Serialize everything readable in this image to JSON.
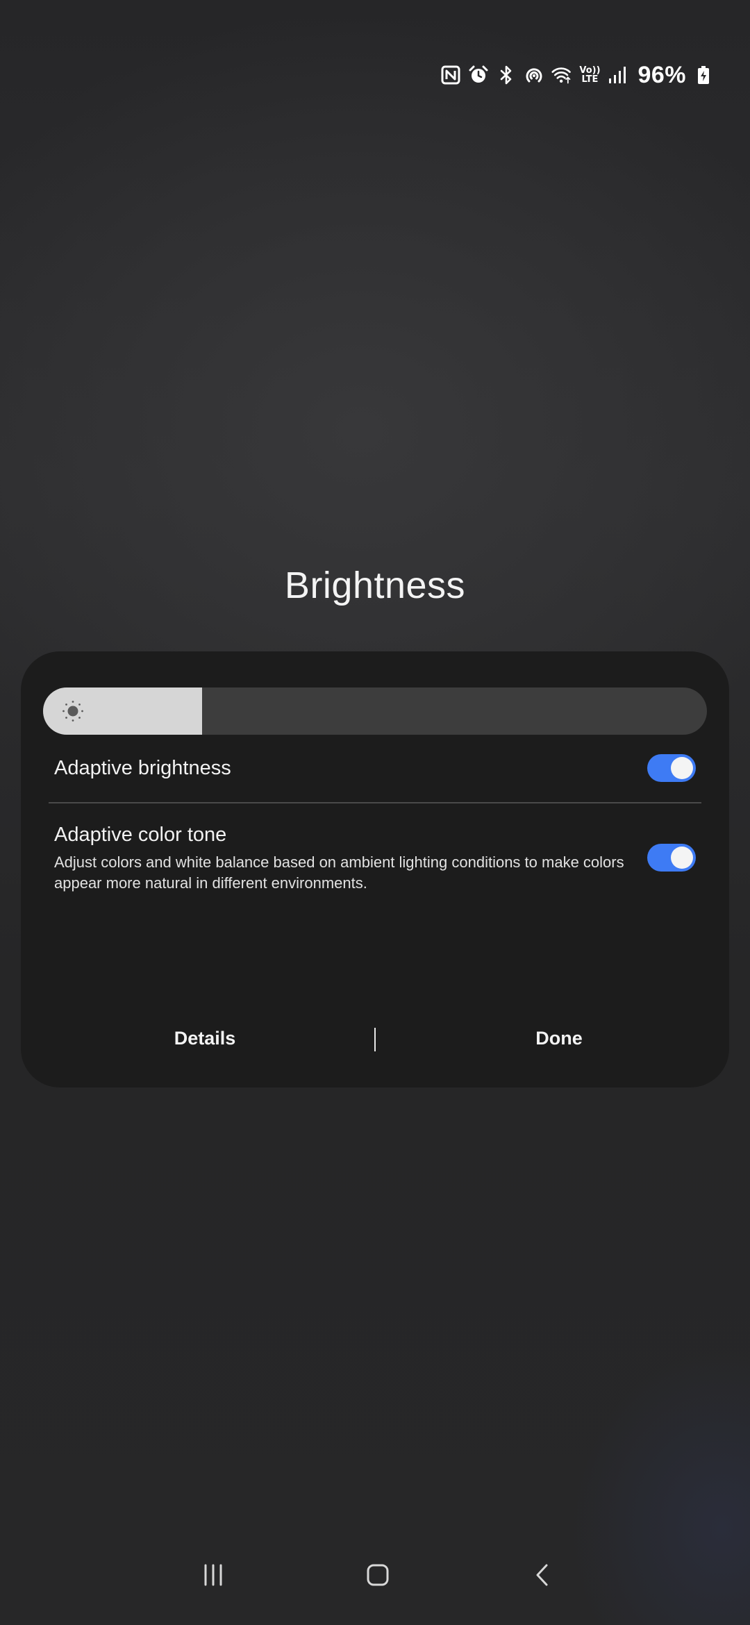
{
  "status_bar": {
    "battery_percent": "96%",
    "volte_top": "Vo))",
    "volte_bottom": "LTE",
    "icons": [
      "nfc-icon",
      "alarm-icon",
      "bluetooth-icon",
      "hotspot-icon",
      "wifi-icon",
      "volte-icon",
      "signal-icon",
      "battery-charging-icon"
    ]
  },
  "dialog": {
    "title": "Brightness",
    "slider": {
      "icon": "sun-icon",
      "level_percent": 24
    },
    "adaptive_brightness": {
      "label": "Adaptive brightness",
      "enabled": true
    },
    "adaptive_color_tone": {
      "label": "Adaptive color tone",
      "description": "Adjust colors and white balance based on ambient lighting conditions to make colors appear more natural in different environments.",
      "enabled": true
    },
    "actions": {
      "details_label": "Details",
      "done_label": "Done"
    }
  },
  "nav_bar": {
    "icons": [
      "recents-icon",
      "home-icon",
      "back-icon"
    ]
  },
  "colors": {
    "toggle_on": "#3e7bf4",
    "panel_bg": "#1c1c1c",
    "slider_fill": "#d6d6d6",
    "slider_track": "#3d3d3d"
  }
}
